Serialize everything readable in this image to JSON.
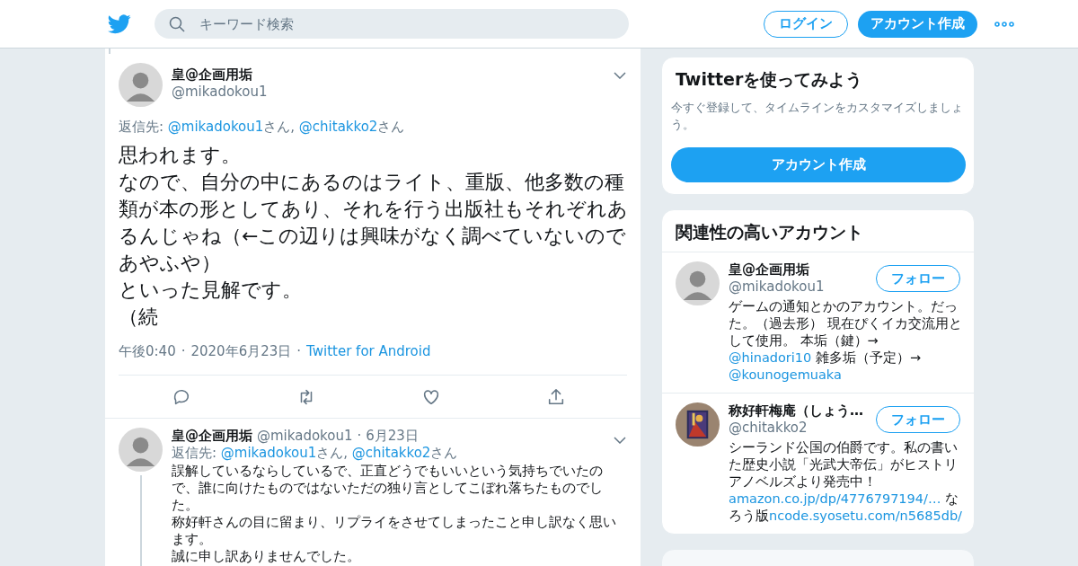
{
  "header": {
    "search": {
      "placeholder": "キーワード検索"
    },
    "login": "ログイン",
    "signup": "アカウント作成"
  },
  "tweets": [
    {
      "kind": "focused",
      "name": "皇@企画用垢",
      "handle": "@mikadokou1",
      "reply_label": "返信先: ",
      "reply_to": [
        {
          "kind": "link",
          "text": "@mikadokou1"
        },
        {
          "kind": "text",
          "text": "さん, "
        },
        {
          "kind": "link",
          "text": "@chitakko2"
        },
        {
          "kind": "text",
          "text": "さん"
        }
      ],
      "body": [
        "思われます。",
        "なので、自分の中にあるのはライト、重版、他多数の種類が本の形としてあり、それを行う出版社もそれぞれあるんじゃね（←この辺りは興味がなく調べていないのであやふや）",
        "といった見解です。",
        "（続"
      ],
      "separator": "·",
      "time": "午後0:40",
      "date": "2020年6月23日",
      "source": "Twitter for Android"
    },
    {
      "kind": "thread",
      "name": "皇@企画用垢",
      "handle": "@mikadokou1",
      "separator": "·",
      "date": "6月23日",
      "reply_label": "返信先: ",
      "reply_to": [
        {
          "kind": "link",
          "text": "@mikadokou1"
        },
        {
          "kind": "text",
          "text": "さん, "
        },
        {
          "kind": "link",
          "text": "@chitakko2"
        },
        {
          "kind": "text",
          "text": "さん"
        }
      ],
      "body": [
        "誤解しているならしているで、正直どうでもいいという気持ちでいたので、誰に向けたものではないただの独り言としてこぼれ落ちたものでした。",
        "称好軒さんの目に留まり、リプライをさせてしまったこと申し訳なく思います。",
        "誠に申し訳ありませんでした。"
      ]
    }
  ],
  "signup_card": {
    "title": "Twitterを使ってみよう",
    "text": "今すぐ登録して、タイムラインをカスタマイズしましょう。",
    "button": "アカウント作成"
  },
  "accounts_card": {
    "title": "関連性の高いアカウント",
    "accounts": [
      {
        "kind": "figure",
        "name": "皇@企画用垢",
        "handle": "@mikadokou1",
        "follow": "フォロー",
        "bio": [
          {
            "kind": "text",
            "text": "ゲームの通知とかのアカウント。だった。（過去形） 現在ぴくイカ交流用として使用。 本垢（鍵）→ "
          },
          {
            "kind": "link",
            "text": "@hinadori10"
          },
          {
            "kind": "text",
            "text": " 雑多垢（予定）→ "
          },
          {
            "kind": "link",
            "text": "@kounogemuaka"
          }
        ]
      },
      {
        "kind": "picture",
        "name": "称好軒梅庵（しょう…",
        "handle": "@chitakko2",
        "follow": "フォロー",
        "bio": [
          {
            "kind": "text",
            "text": "シーランド公国の伯爵です。私の書いた歴史小説「光武大帝伝」がヒストリアノベルズより発売中！ "
          },
          {
            "kind": "link",
            "text": "amazon.co.jp/dp/4776797194/…"
          },
          {
            "kind": "text",
            "text": " なろう版"
          },
          {
            "kind": "link",
            "text": "ncode.syosetu.com/n5685db/"
          }
        ]
      }
    ]
  }
}
